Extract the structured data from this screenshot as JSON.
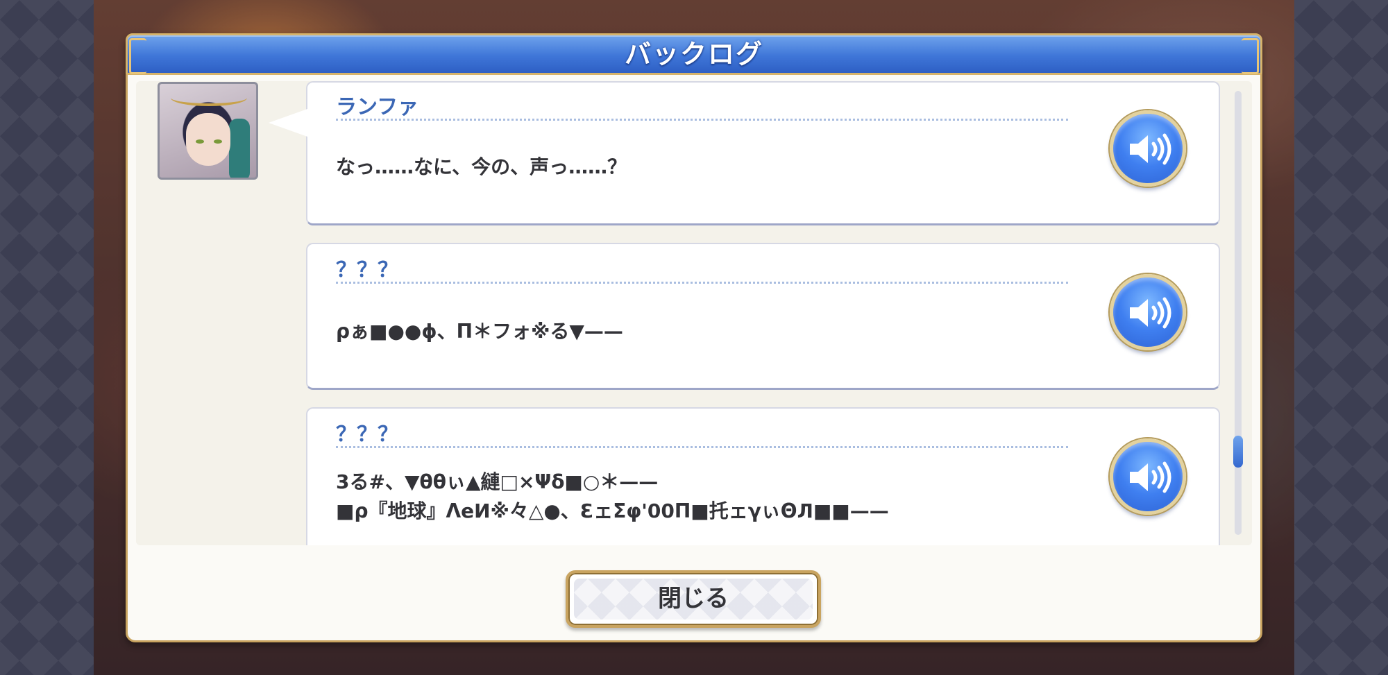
{
  "window": {
    "title": "バックログ"
  },
  "log": [
    {
      "speaker": "ランファ",
      "lines": [
        "なっ……なに、今の、声っ……？"
      ],
      "has_portrait": true
    },
    {
      "speaker": "？？？",
      "lines": [
        "ρぁ■●●ɸ、Π＊フォ※る▼——"
      ],
      "has_portrait": false
    },
    {
      "speaker": "？？？",
      "lines": [
        "3る#、▼θθぃ▲縺□×Ψδ■○＊——",
        "■ρ『地球』ΛeИ※々△●、ƐェΣφ'00Π■托ェγぃΘЛ■■——"
      ],
      "has_portrait": false
    }
  ],
  "scroll": {
    "position_fraction": 0.78
  },
  "footer": {
    "close_label": "閉じる"
  },
  "icons": {
    "voice": "speaker-sound-icon"
  },
  "colors": {
    "title_bar": "#3f76d8",
    "gold_border": "#c9a460",
    "speaker_name": "#3b67b5",
    "voice_button": "#3f7ff0"
  }
}
